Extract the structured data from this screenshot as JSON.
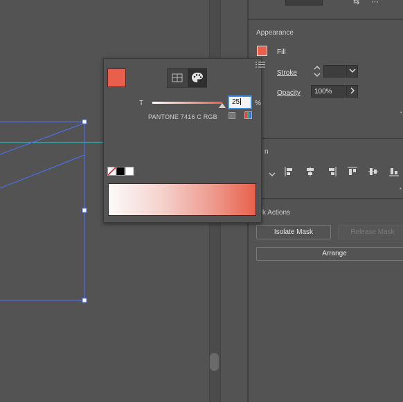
{
  "colors": {
    "fill": "#e8604c",
    "selection": "#4a72ff",
    "guide": "#21d4d4",
    "focus": "#3d8ee8"
  },
  "appearance": {
    "title": "Appearance",
    "fill_label": "Fill",
    "stroke_label": "Stroke",
    "opacity_label": "Opacity",
    "opacity_value": "100%",
    "menu_icon": "panel-menu-icon"
  },
  "align": {
    "title": "n"
  },
  "mask": {
    "title": "k Actions",
    "isolate_label": "Isolate Mask",
    "release_label": "Release Mask",
    "arrange_label": "Arrange"
  },
  "swatch_popup": {
    "tint_label": "T",
    "tint_value": "25",
    "tint_level_percent": 25,
    "percent_label": "%",
    "pantone_name": "PANTONE 7416 C RGB",
    "tabs": [
      "swatches-grid-icon",
      "color-palette-icon"
    ],
    "active_tab": 1
  }
}
